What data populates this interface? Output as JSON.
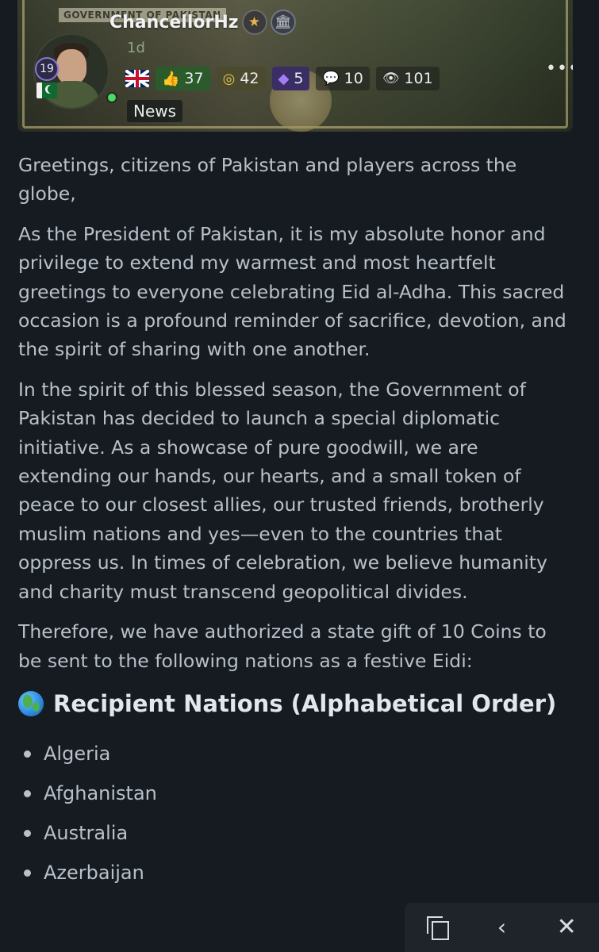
{
  "post": {
    "author": "ChancellorHz",
    "time_ago": "1d",
    "level": "19",
    "banner_text": "GOVERNMENT OF PAKISTAN",
    "tag": "News",
    "stats": {
      "votes": "37",
      "coins": "42",
      "gems": "5",
      "comments": "10",
      "views": "101"
    },
    "more_label": "•••"
  },
  "article": {
    "paragraphs": [
      "Greetings, citizens of Pakistan and players across the globe,",
      "As the President of Pakistan, it is my absolute honor and privilege to extend my warmest and most heartfelt greetings to everyone celebrating Eid al-Adha. This sacred occasion is a profound reminder of sacrifice, devotion, and the spirit of sharing with one another.",
      "In the spirit of this blessed season, the Government of Pakistan has decided to launch a special diplomatic initiative. As a showcase of pure goodwill, we are extending our hands, our hearts, and a small token of peace to our closest allies, our trusted friends, brotherly muslim nations and yes—even to the countries that oppress us. In times of celebration, we believe humanity and charity must transcend geopolitical divides.",
      "Therefore, we have authorized a state gift of 10 Coins to be sent to the following nations as a festive Eidi:"
    ],
    "section_heading": "Recipient Nations (Alphabetical Order)",
    "nations": [
      "Algeria",
      "Afghanistan",
      "Australia",
      "Azerbaijan"
    ]
  },
  "colors": {
    "background": "#161b21",
    "text": "#b8c0c9",
    "votes_accent": "#5bd15b",
    "coins_accent": "#e3c457",
    "gems_accent": "#a47cf5"
  },
  "icons": [
    "star-icon",
    "government-icon",
    "uk-flag-icon",
    "pakistan-flag-icon",
    "thumbs-icon",
    "coins-icon",
    "gem-icon",
    "comment-icon",
    "eye-icon",
    "globe-icon",
    "copy-icon",
    "chevron-left-icon",
    "close-icon"
  ]
}
